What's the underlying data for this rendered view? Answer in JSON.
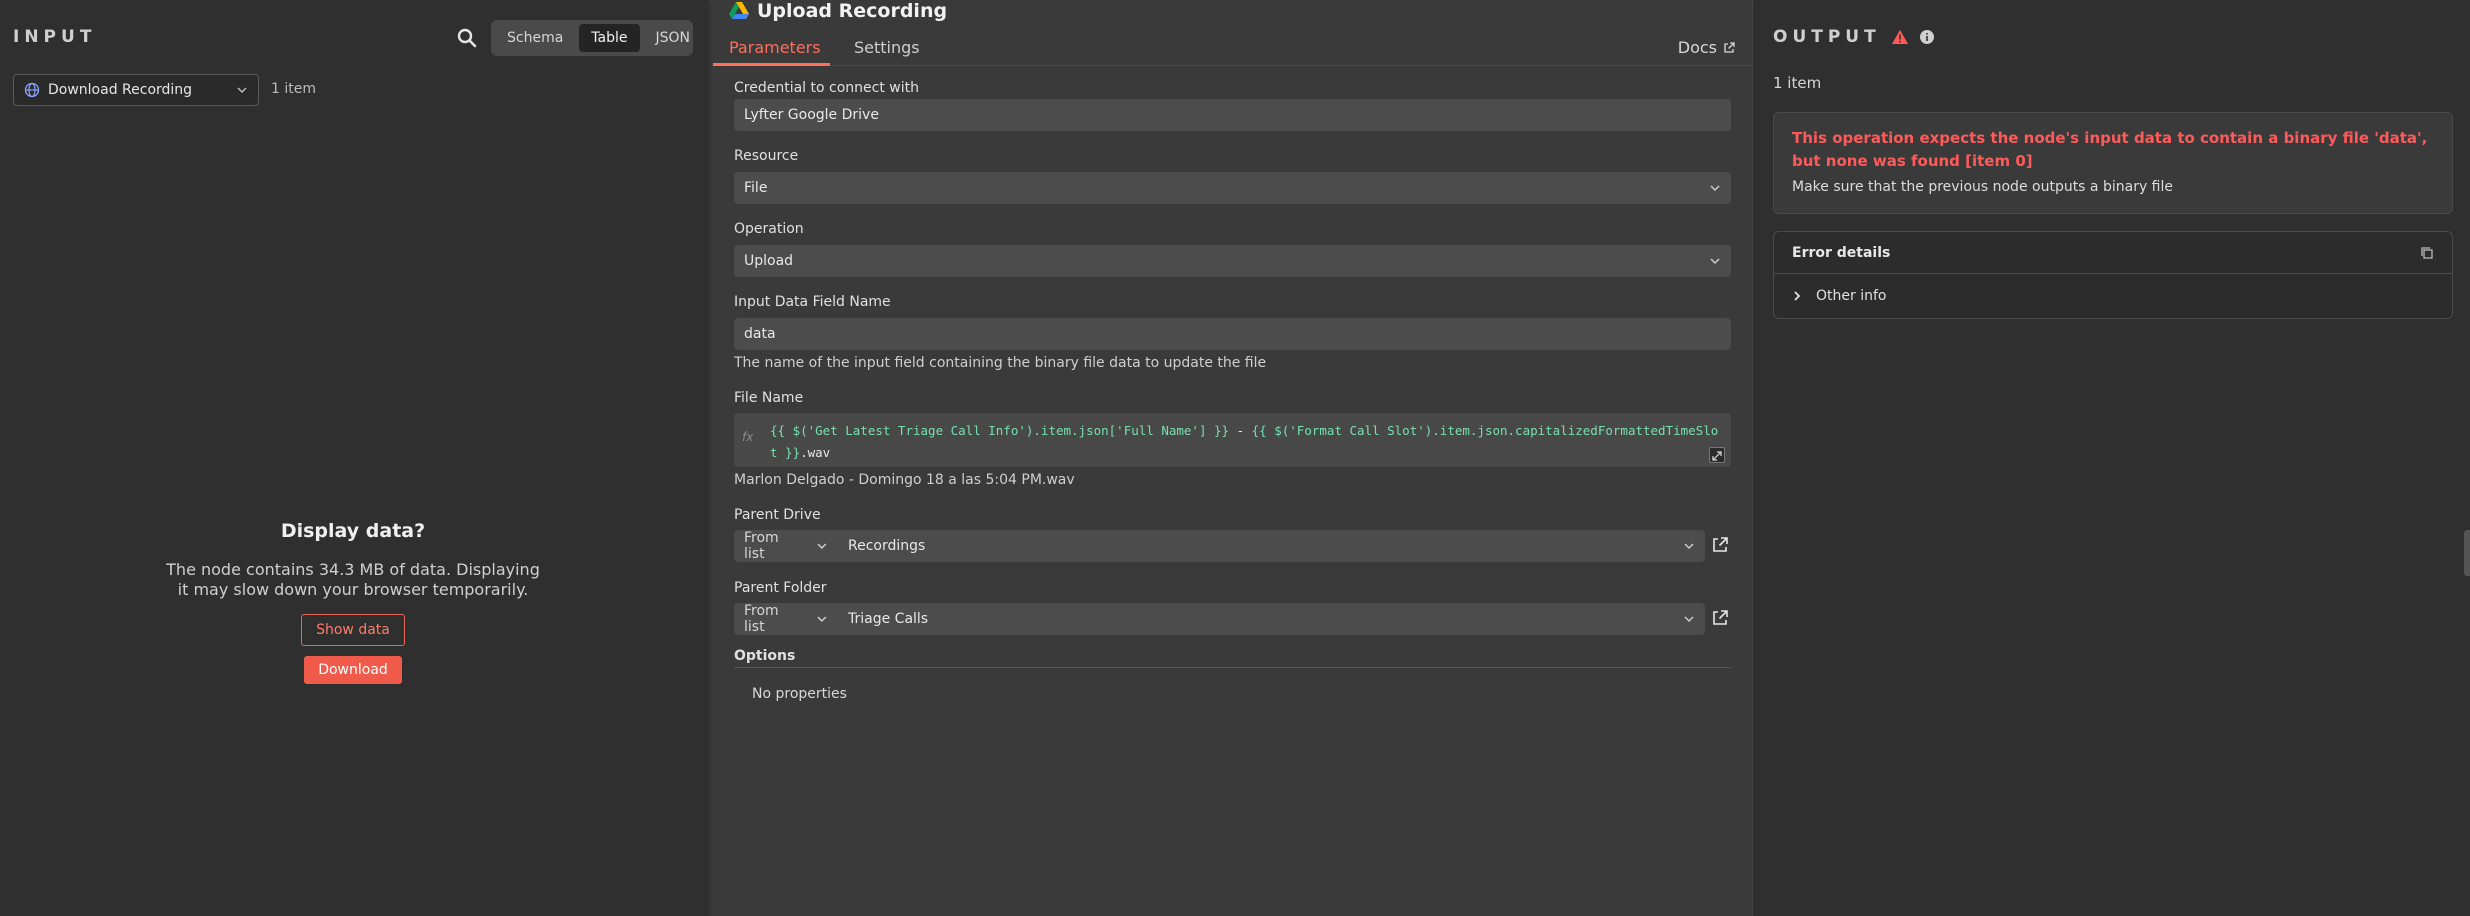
{
  "input_panel": {
    "label": "INPUT",
    "view_modes": [
      "Schema",
      "Table",
      "JSON"
    ],
    "active_view": "Table",
    "node_select": "Download Recording",
    "item_count": "1 item",
    "display_title": "Display data?",
    "display_text": "The node contains 34.3 MB of data. Displaying it may slow down your browser temporarily.",
    "show_data_label": "Show data",
    "download_label": "Download"
  },
  "center_panel": {
    "node_title": "Upload Recording",
    "tabs": [
      "Parameters",
      "Settings"
    ],
    "docs_label": "Docs",
    "credential": {
      "label": "Credential to connect with",
      "value": "Lyfter Google Drive"
    },
    "resource": {
      "label": "Resource",
      "value": "File"
    },
    "operation": {
      "label": "Operation",
      "value": "Upload"
    },
    "input_field": {
      "label": "Input Data Field Name",
      "value": "data",
      "hint": "The name of the input field containing the binary file data to update the file"
    },
    "file_name": {
      "label": "File Name",
      "expr_part1": "{{ $('Get Latest Triage Call Info').item.json['Full Name'] }}",
      "expr_mid": " - ",
      "expr_part2": "{{ $('Format Call Slot').item.json.capitalizedFormattedTimeSlot }}",
      "expr_suffix": ".wav",
      "preview": "Marlon Delgado - Domingo 18 a las 5:04 PM.wav"
    },
    "parent_drive": {
      "label": "Parent Drive",
      "mode": "From list",
      "value": "Recordings"
    },
    "parent_folder": {
      "label": "Parent Folder",
      "mode": "From list",
      "value": "Triage Calls"
    },
    "options": {
      "label": "Options",
      "empty_text": "No properties"
    }
  },
  "output_panel": {
    "label": "OUTPUT",
    "item_count": "1 item",
    "error_title": "This operation expects the node's input data to contain a binary file 'data', but none was found [item 0]",
    "error_sub": "Make sure that the previous node outputs a binary file",
    "details_title": "Error details",
    "other_info": "Other info"
  },
  "colors": {
    "accent": "#ff6f5c",
    "error": "#ff5a5a",
    "code": "#77e0b0"
  }
}
